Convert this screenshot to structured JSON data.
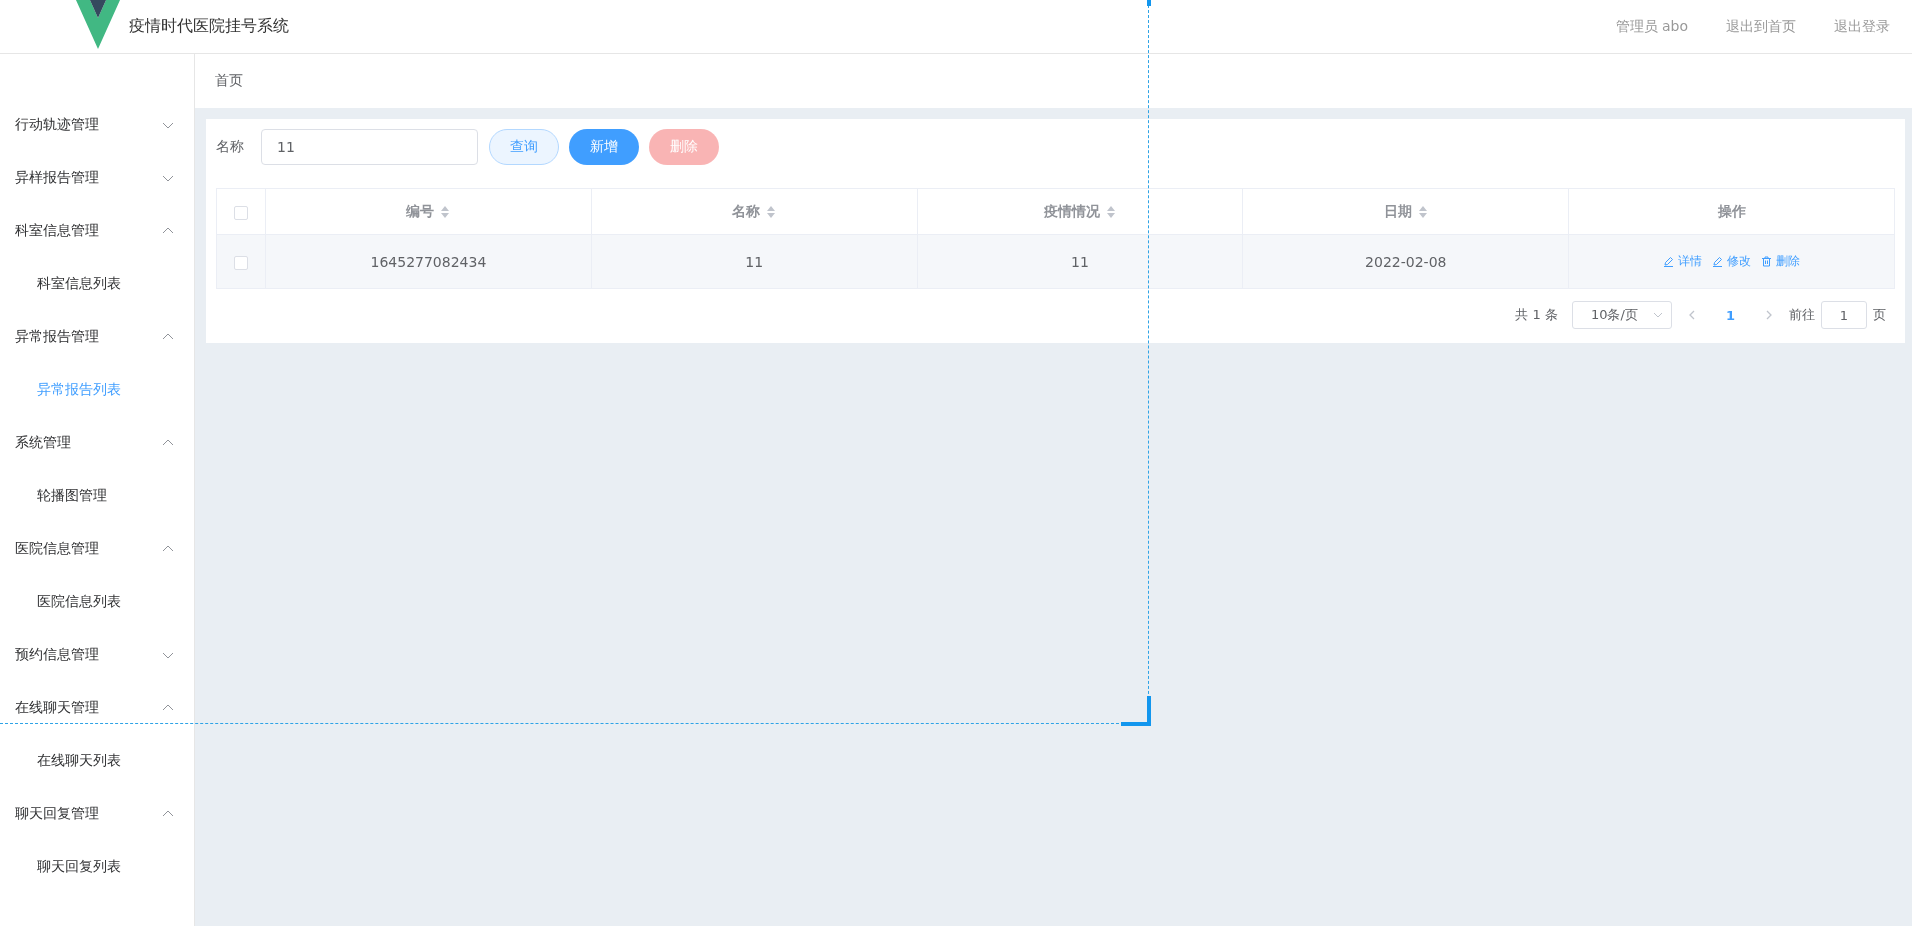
{
  "header": {
    "title": "疫情时代医院挂号系统",
    "user": "管理员 abo",
    "links": [
      "退出到首页",
      "退出登录"
    ]
  },
  "sidebar": {
    "items": [
      {
        "label": "行动轨迹管理",
        "expanded": false
      },
      {
        "label": "异样报告管理",
        "expanded": false
      },
      {
        "label": "科室信息管理",
        "expanded": true,
        "children": [
          {
            "label": "科室信息列表",
            "selected": false
          }
        ]
      },
      {
        "label": "异常报告管理",
        "expanded": true,
        "children": [
          {
            "label": "异常报告列表",
            "selected": true
          }
        ]
      },
      {
        "label": "系统管理",
        "expanded": true,
        "children": [
          {
            "label": "轮播图管理",
            "selected": false
          }
        ]
      },
      {
        "label": "医院信息管理",
        "expanded": true,
        "children": [
          {
            "label": "医院信息列表",
            "selected": false
          }
        ]
      },
      {
        "label": "预约信息管理",
        "expanded": false
      },
      {
        "label": "在线聊天管理",
        "expanded": true,
        "children": [
          {
            "label": "在线聊天列表",
            "selected": false
          }
        ]
      },
      {
        "label": "聊天回复管理",
        "expanded": true,
        "children": [
          {
            "label": "聊天回复列表",
            "selected": false
          }
        ]
      }
    ]
  },
  "breadcrumb": [
    "首页"
  ],
  "search": {
    "label": "名称",
    "value": "11",
    "buttons": [
      {
        "label": "查询",
        "kind": "query",
        "disabled": false
      },
      {
        "label": "新增",
        "kind": "add",
        "disabled": false
      },
      {
        "label": "删除",
        "kind": "delete",
        "disabled": true
      }
    ]
  },
  "table": {
    "header_checked": false,
    "columns": [
      {
        "label": "编号",
        "sortable": true
      },
      {
        "label": "名称",
        "sortable": true
      },
      {
        "label": "疫情情况",
        "sortable": true
      },
      {
        "label": "日期",
        "sortable": true
      },
      {
        "label": "操作",
        "sortable": false
      }
    ],
    "rows": [
      {
        "checked": false,
        "cells": [
          "1645277082434",
          "11",
          "11",
          "2022-02-08"
        ],
        "actions": [
          {
            "label": "详情",
            "kind": "edit"
          },
          {
            "label": "修改",
            "kind": "edit"
          },
          {
            "label": "删除",
            "kind": "delete"
          }
        ]
      }
    ]
  },
  "pagination": {
    "total": "共 1 条",
    "page_size": "10条/页",
    "pages": [
      {
        "label": "1",
        "selected": true
      }
    ],
    "jump_label": "前往",
    "jump_value": "1",
    "page_unit": "页"
  }
}
